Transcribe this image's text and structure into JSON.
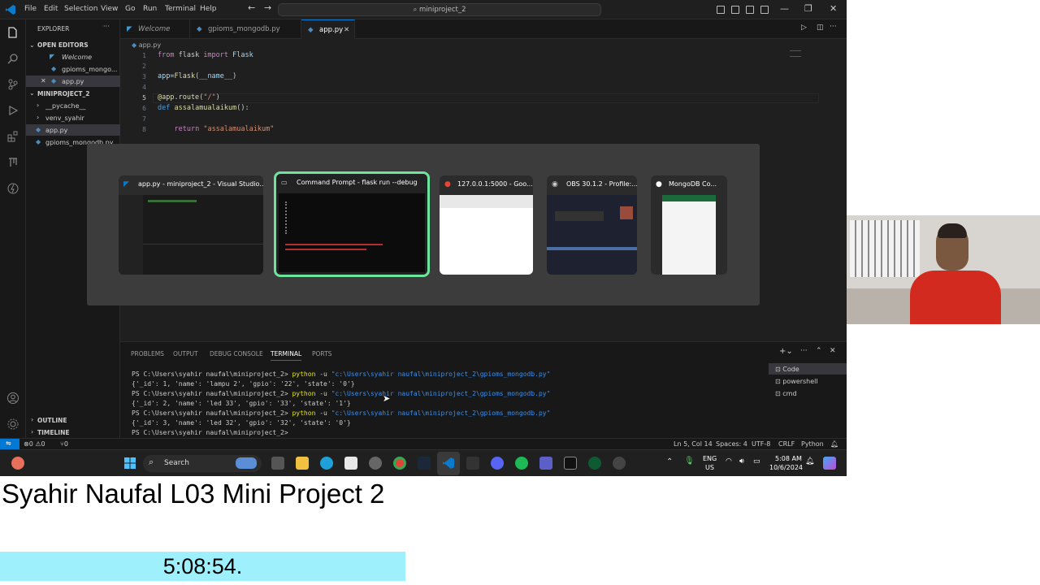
{
  "vscode": {
    "menu": [
      "File",
      "Edit",
      "Selection",
      "View",
      "Go",
      "Run",
      "Terminal",
      "Help"
    ],
    "command_center": "miniproject_2",
    "tabs": [
      {
        "label": "Welcome",
        "active": false
      },
      {
        "label": "gpioms_mongodb.py",
        "active": false
      },
      {
        "label": "app.py",
        "active": true
      }
    ],
    "breadcrumb": "app.py",
    "explorer": {
      "title": "EXPLORER",
      "open_editors_header": "OPEN EDITORS",
      "open_editors": [
        "Welcome",
        "gpioms_mongo...",
        "app.py"
      ],
      "project_header": "MINIPROJECT_2",
      "files": [
        "__pycache__",
        "venv_syahir",
        "app.py",
        "gpioms_mongodb.py"
      ],
      "outline": "OUTLINE",
      "timeline": "TIMELINE"
    },
    "code_lines": [
      {
        "n": "1",
        "text": "from flask import Flask"
      },
      {
        "n": "2",
        "text": ""
      },
      {
        "n": "3",
        "text": "app=Flask(__name__)"
      },
      {
        "n": "4",
        "text": ""
      },
      {
        "n": "5",
        "text": "@app.route(\"/\")"
      },
      {
        "n": "6",
        "text": "def assalamualaikum():"
      },
      {
        "n": "7",
        "text": ""
      },
      {
        "n": "8",
        "text": "    return \"assalamualaikum\""
      }
    ],
    "panel_tabs": [
      "PROBLEMS",
      "OUTPUT",
      "DEBUG CONSOLE",
      "TERMINAL",
      "PORTS"
    ],
    "terminal": {
      "prompt": "PS C:\\Users\\syahir naufal\\miniproject_2>",
      "cmd": "python",
      "flag": "-u",
      "path": "\"c:\\Users\\syahir naufal\\miniproject_2\\gpioms_mongodb.py\"",
      "outputs": [
        "{'_id': 1, 'name': 'lampu 2', 'gpio': '22', 'state': '0'}",
        "{'_id': 2, 'name': 'led 33', 'gpio': '33', 'state': '1'}",
        "{'_id': 3, 'name': 'led 32', 'gpio': '32', 'state': '0'}"
      ],
      "shells": [
        "Code",
        "powershell",
        "cmd"
      ]
    },
    "status": {
      "errors": "0",
      "warnings": "0",
      "ports": "0",
      "position": "Ln 5, Col 14",
      "spaces": "Spaces: 4",
      "encoding": "UTF-8",
      "eol": "CRLF",
      "language": "Python"
    }
  },
  "alt_tab": {
    "windows": [
      {
        "title": "app.py - miniproject_2 - Visual Studio...",
        "selected": false
      },
      {
        "title": "Command Prompt - flask  run --debug",
        "selected": true
      },
      {
        "title": "127.0.0.1:5000 - Goo...",
        "selected": false
      },
      {
        "title": "OBS 30.1.2 - Profile:...",
        "selected": false
      },
      {
        "title": "MongoDB Co...",
        "selected": false
      }
    ]
  },
  "taskbar": {
    "search": "Search",
    "lang": "ENG",
    "region": "US",
    "time": "5:08 AM",
    "date": "10/6/2024"
  },
  "overlay": {
    "caption": "Syahir Naufal L03 Mini Project 2",
    "timer": "5:08:54."
  }
}
